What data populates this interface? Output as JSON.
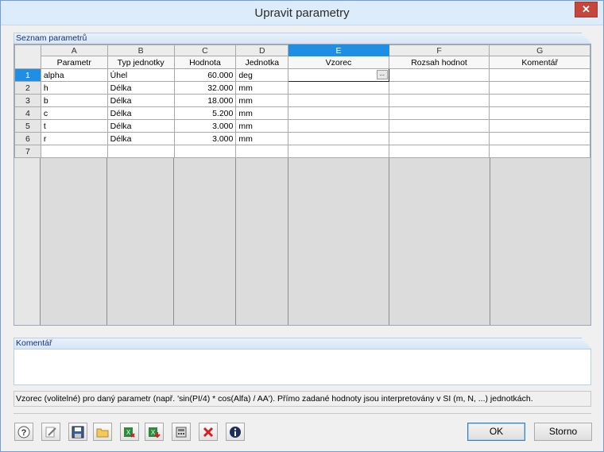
{
  "window": {
    "title": "Upravit parametry",
    "close_symbol": "✕"
  },
  "grid_section": {
    "label": "Seznam parametrů"
  },
  "grid": {
    "column_letters": [
      "A",
      "B",
      "C",
      "D",
      "E",
      "F",
      "G"
    ],
    "column_names": [
      "Parametr",
      "Typ jednotky",
      "Hodnota",
      "Jednotka",
      "Vzorec",
      "Rozsah hodnot",
      "Komentář"
    ],
    "rows": [
      {
        "num": "1",
        "cells": [
          "alpha",
          "Úhel",
          "60.000",
          "deg",
          "",
          "",
          ""
        ]
      },
      {
        "num": "2",
        "cells": [
          "h",
          "Délka",
          "32.000",
          "mm",
          "",
          "",
          ""
        ]
      },
      {
        "num": "3",
        "cells": [
          "b",
          "Délka",
          "18.000",
          "mm",
          "",
          "",
          ""
        ]
      },
      {
        "num": "4",
        "cells": [
          "c",
          "Délka",
          "5.200",
          "mm",
          "",
          "",
          ""
        ]
      },
      {
        "num": "5",
        "cells": [
          "t",
          "Délka",
          "3.000",
          "mm",
          "",
          "",
          ""
        ]
      },
      {
        "num": "6",
        "cells": [
          "r",
          "Délka",
          "3.000",
          "mm",
          "",
          "",
          ""
        ]
      },
      {
        "num": "7",
        "cells": [
          "",
          "",
          "",
          "",
          "",
          "",
          ""
        ]
      }
    ],
    "active_row": "1",
    "active_column": "E",
    "cell_button": "..."
  },
  "comment_section": {
    "label": "Komentář",
    "value": ""
  },
  "status_text": "Vzorec (volitelné) pro daný parametr (např. 'sin(PI/4) * cos(Alfa) / AA'). Přímo zadané hodnoty jsou interpretovány v SI (m, N, ...) jednotkách.",
  "buttons": {
    "ok": "OK",
    "cancel": "Storno"
  },
  "toolbar_icons": [
    "help-icon",
    "edit-icon",
    "save-icon",
    "open-folder-icon",
    "export-excel-icon",
    "import-excel-icon",
    "calculator-icon",
    "delete-icon",
    "info-icon"
  ],
  "colors": {
    "accent": "#1e8fe4",
    "title_bar": "#dcecfb",
    "section_text": "#14337a",
    "close": "#c7463b"
  }
}
